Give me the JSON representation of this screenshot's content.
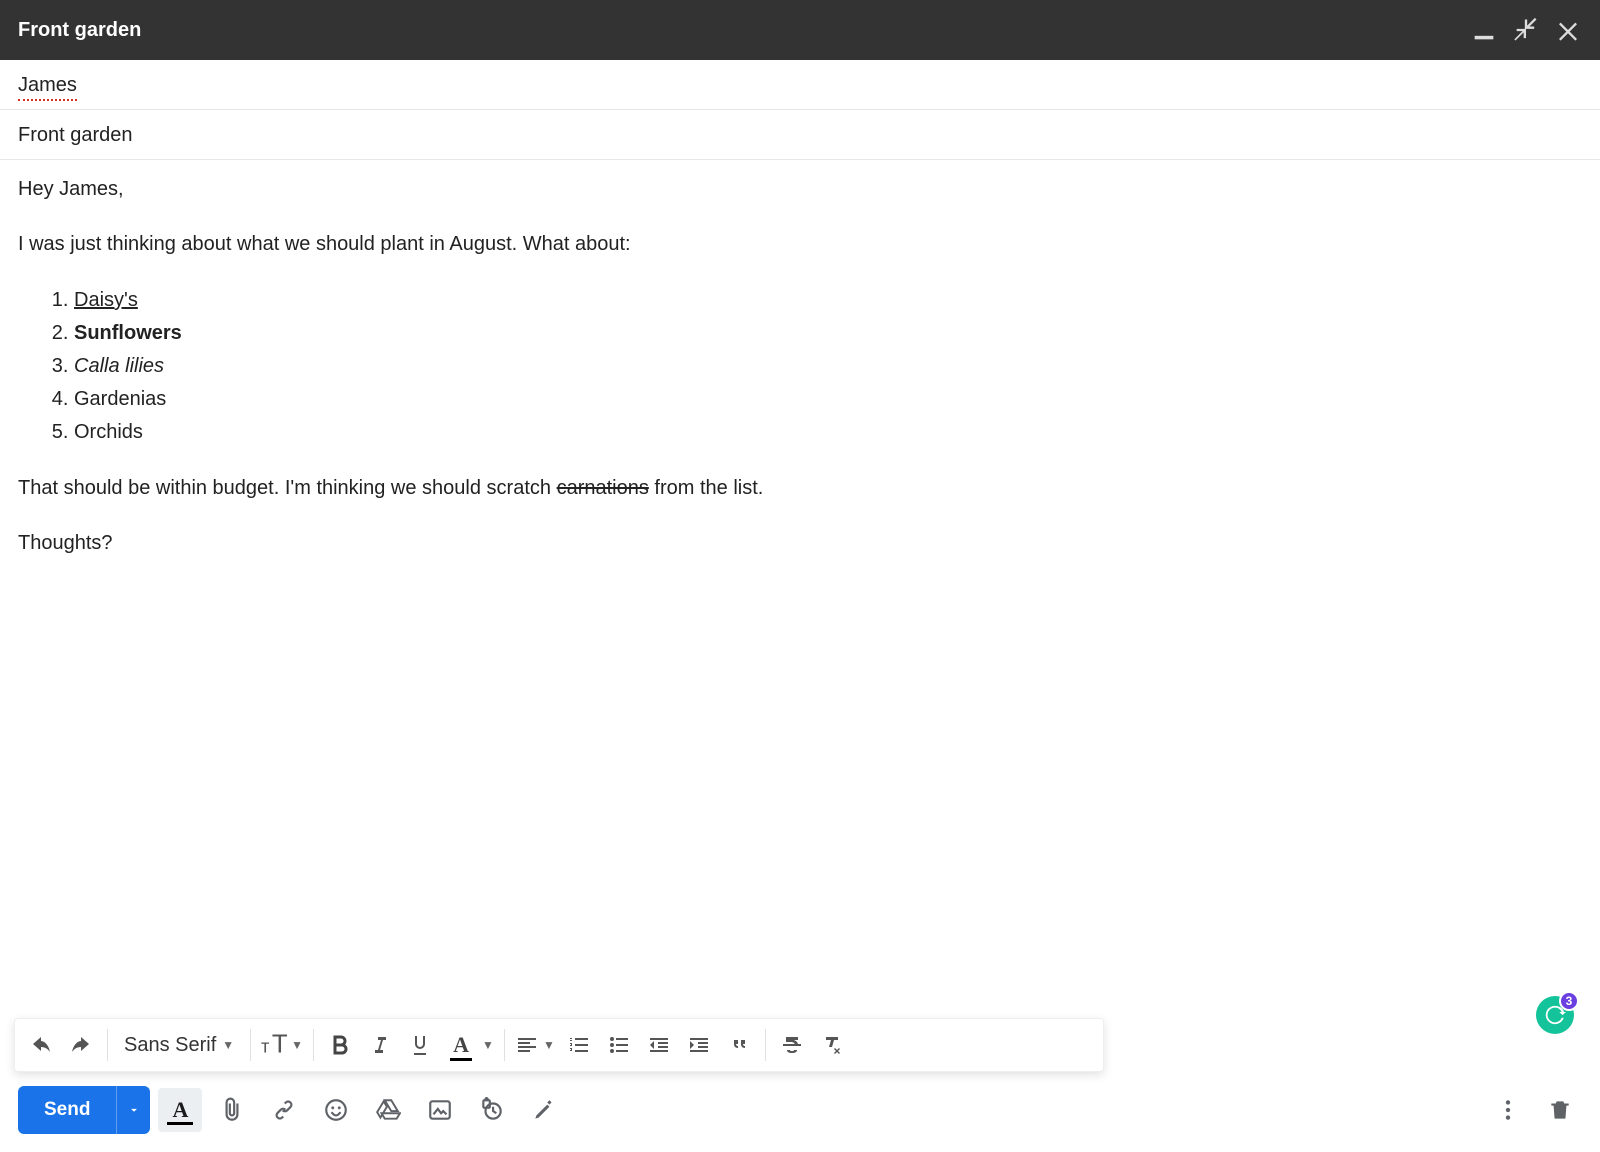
{
  "titlebar": {
    "title": "Front garden"
  },
  "compose": {
    "to": "James",
    "subject": "Front garden",
    "body": {
      "greeting": "Hey James,",
      "intro": "I was just thinking about what we should plant in August. What about:",
      "list": [
        {
          "text": "Daisy's",
          "style": "underline"
        },
        {
          "text": "Sunflowers",
          "style": "bold"
        },
        {
          "text": "Calla lilies",
          "style": "italic"
        },
        {
          "text": "Gardenias",
          "style": "none"
        },
        {
          "text": "Orchids",
          "style": "none"
        }
      ],
      "para2_pre": "That should be within budget. I'm thinking we should scratch ",
      "para2_strike": "carnations",
      "para2_post": " from the list.",
      "closing": "Thoughts?"
    }
  },
  "format_toolbar": {
    "font_family": "Sans Serif"
  },
  "actions": {
    "send_label": "Send"
  },
  "grammarly": {
    "count": "3"
  }
}
